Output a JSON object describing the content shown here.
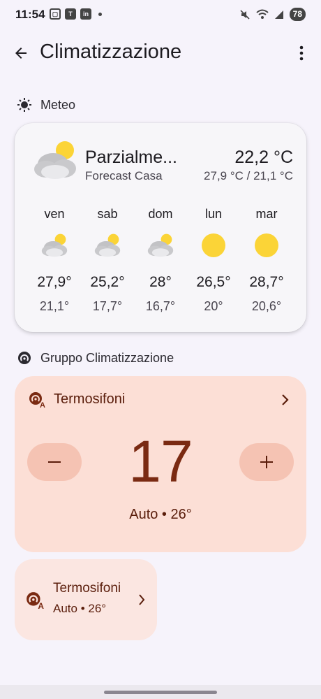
{
  "status_bar": {
    "time": "11:54",
    "battery": "78",
    "left_icons": [
      "screenshot-icon",
      "teams-icon",
      "linkedin-icon",
      "notification-dot-icon"
    ],
    "right_icons": [
      "mute-icon",
      "wifi-icon",
      "signal-icon"
    ]
  },
  "app_bar": {
    "title": "Climatizzazione",
    "back_icon": "arrow-back-icon",
    "menu_icon": "more-vert-icon"
  },
  "weather_section": {
    "label": "Meteo",
    "icon": "weather-sun-icon"
  },
  "weather": {
    "condition": "Parzialme...",
    "place": "Forecast Casa",
    "temperature": "22,2 °C",
    "range": "27,9 °C / 21,1 °C",
    "icon": "partly-cloudy-icon",
    "forecast": [
      {
        "day": "ven",
        "max": "27,9°",
        "min": "21,1°",
        "icon": "partly-cloudy-icon"
      },
      {
        "day": "sab",
        "max": "25,2°",
        "min": "17,7°",
        "icon": "partly-cloudy-icon"
      },
      {
        "day": "dom",
        "max": "28°",
        "min": "16,7°",
        "icon": "partly-cloudy-icon"
      },
      {
        "day": "lun",
        "max": "26,5°",
        "min": "20°",
        "icon": "sunny-icon"
      },
      {
        "day": "mar",
        "max": "28,7°",
        "min": "20,6°",
        "icon": "sunny-icon"
      }
    ]
  },
  "climate_section": {
    "label": "Gruppo Climatizzazione",
    "icon": "thermostat-group-icon"
  },
  "climate_card": {
    "name": "Termosifoni",
    "setpoint": "17",
    "status": "Auto • 26°",
    "icon": "thermostat-auto-icon"
  },
  "climate_tile": {
    "name": "Termosifoni",
    "status": "Auto • 26°",
    "icon": "thermostat-auto-icon"
  },
  "colors": {
    "background": "#f6f3fb",
    "weather_card": "#f7f6f9",
    "climate_card": "#fcdfd6",
    "climate_button": "#f5c3b3",
    "climate_text": "#7a2a12",
    "climate_tile": "#fbe6e1",
    "sun": "#fbd437",
    "cloud": "#c9c9cc"
  }
}
